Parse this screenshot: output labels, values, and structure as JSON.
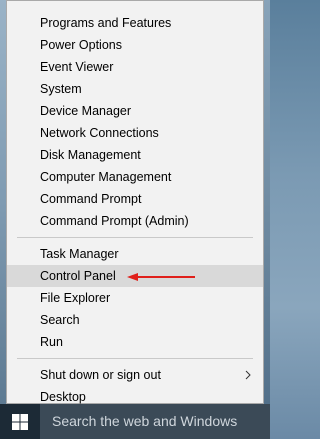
{
  "menu": {
    "groups": [
      [
        "Programs and Features",
        "Power Options",
        "Event Viewer",
        "System",
        "Device Manager",
        "Network Connections",
        "Disk Management",
        "Computer Management",
        "Command Prompt",
        "Command Prompt (Admin)"
      ],
      [
        "Task Manager",
        "Control Panel",
        "File Explorer",
        "Search",
        "Run"
      ],
      [
        "Shut down or sign out",
        "Desktop"
      ]
    ],
    "selected_item": "Control Panel",
    "submenu_item": "Shut down or sign out"
  },
  "annotation": {
    "arrow_color": "#e0201b"
  },
  "taskbar": {
    "search_placeholder": "Search the web and Windows",
    "start_icon": "windows-logo-icon"
  },
  "colors": {
    "menu_bg": "#f2f2f2",
    "selected_bg": "#d9d9d9",
    "taskbar_bg": "#1c2a36",
    "search_bg": "#3b4a57"
  }
}
